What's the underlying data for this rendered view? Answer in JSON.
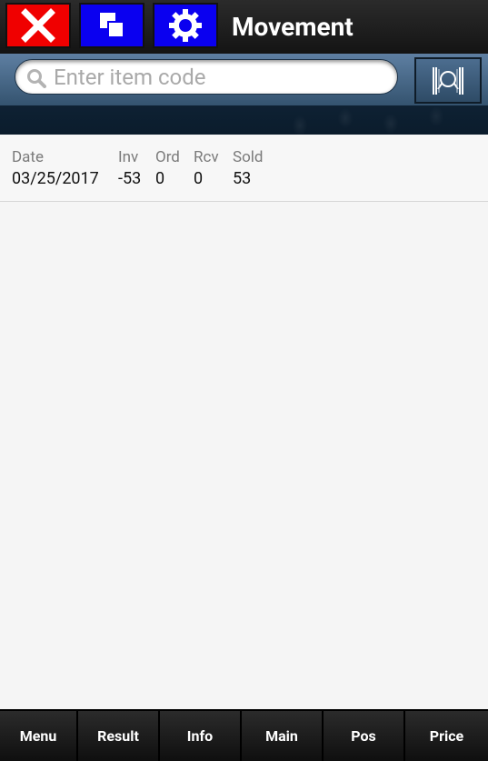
{
  "header": {
    "title": "Movement",
    "buttons": [
      {
        "name": "close",
        "icon": "x-icon",
        "color": "#f00000"
      },
      {
        "name": "copy",
        "icon": "overlapping-squares-icon",
        "color": "#0a00f0"
      },
      {
        "name": "settings",
        "icon": "gear-icon",
        "color": "#0a00f0"
      }
    ]
  },
  "search": {
    "placeholder": "Enter item code",
    "value": "",
    "scan_icon": "barcode-scan-icon"
  },
  "movement": {
    "headers": [
      "Date",
      "Inv",
      "Ord",
      "Rcv",
      "Sold"
    ],
    "rows": [
      [
        "03/25/2017",
        "-53",
        "0",
        "0",
        "53"
      ]
    ]
  },
  "nav": {
    "items": [
      "Menu",
      "Result",
      "Info",
      "Main",
      "Pos",
      "Price"
    ]
  }
}
